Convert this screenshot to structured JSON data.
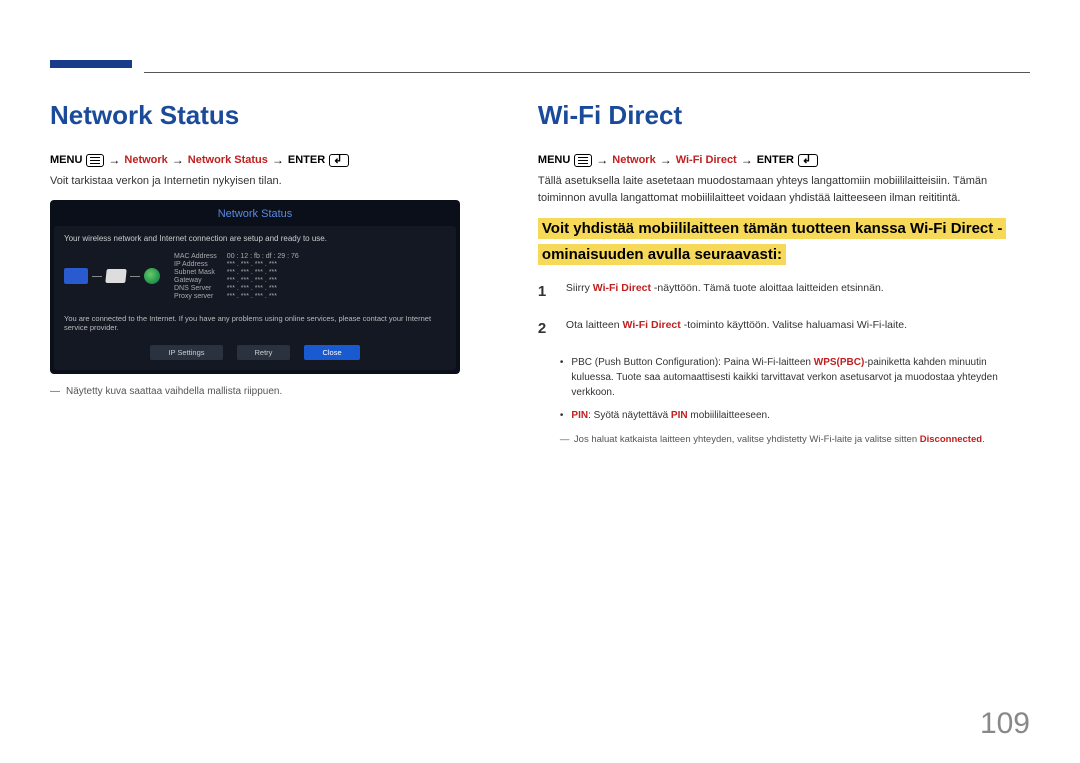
{
  "page_number": "109",
  "left": {
    "title": "Network Status",
    "path": {
      "menu": "MENU",
      "p1": "Network",
      "p2": "Network Status",
      "enter": "ENTER"
    },
    "desc": "Voit tarkistaa verkon ja Internetin nykyisen tilan.",
    "shot": {
      "title": "Network Status",
      "msg1": "Your wireless network and Internet connection are setup and ready to use.",
      "labels": {
        "mac": "MAC Address",
        "ip": "IP Address",
        "subnet": "Subnet Mask",
        "gateway": "Gateway",
        "dns": "DNS Server",
        "proxy": "Proxy server"
      },
      "values": {
        "mac": "00 : 12 : fb : df : 29 : 76",
        "ip": "*** . *** . *** . ***",
        "subnet": "*** . *** . *** . ***",
        "gateway": "*** . *** . *** . ***",
        "dns": "*** . *** . *** . ***",
        "proxy": "*** . *** . *** . ***"
      },
      "msg2": "You are connected to the Internet. If you have any problems using online services, please contact your Internet service provider.",
      "btn1": "IP Settings",
      "btn2": "Retry",
      "btn3": "Close"
    },
    "note": "Näytetty kuva saattaa vaihdella mallista riippuen."
  },
  "right": {
    "title": "Wi-Fi Direct",
    "path": {
      "menu": "MENU",
      "p1": "Network",
      "p2": "Wi-Fi Direct",
      "enter": "ENTER"
    },
    "desc": "Tällä asetuksella laite asetetaan muodostamaan yhteys langattomiin mobiililaitteisiin. Tämän toiminnon avulla langattomat mobiililaitteet voidaan yhdistää laitteeseen ilman reititintä.",
    "highlight": "Voit yhdistää mobiililaitteen tämän tuotteen kanssa Wi-Fi Direct -ominaisuuden avulla seuraavasti:",
    "step1": {
      "pre": "Siirry ",
      "red": "Wi-Fi Direct",
      "post": " -näyttöön. Tämä tuote aloittaa laitteiden etsinnän."
    },
    "step2": {
      "pre": "Ota laitteen ",
      "red": "Wi-Fi Direct",
      "post": " -toiminto käyttöön. Valitse haluamasi Wi-Fi-laite."
    },
    "bullet1": {
      "pre": "PBC (Push Button Configuration): Paina Wi-Fi-laitteen ",
      "red": "WPS(PBC)",
      "post": "-painiketta kahden minuutin kuluessa. Tuote saa automaattisesti kaikki tarvittavat verkon asetusarvot ja muodostaa yhteyden verkkoon."
    },
    "bullet2": {
      "red1": "PIN",
      "mid": ": Syötä näytettävä ",
      "red2": "PIN",
      "post": " mobiililaitteeseen."
    },
    "note2": {
      "pre": "Jos haluat katkaista laitteen yhteyden, valitse yhdistetty Wi-Fi-laite ja valitse sitten ",
      "red": "Disconnected",
      "post": "."
    }
  }
}
